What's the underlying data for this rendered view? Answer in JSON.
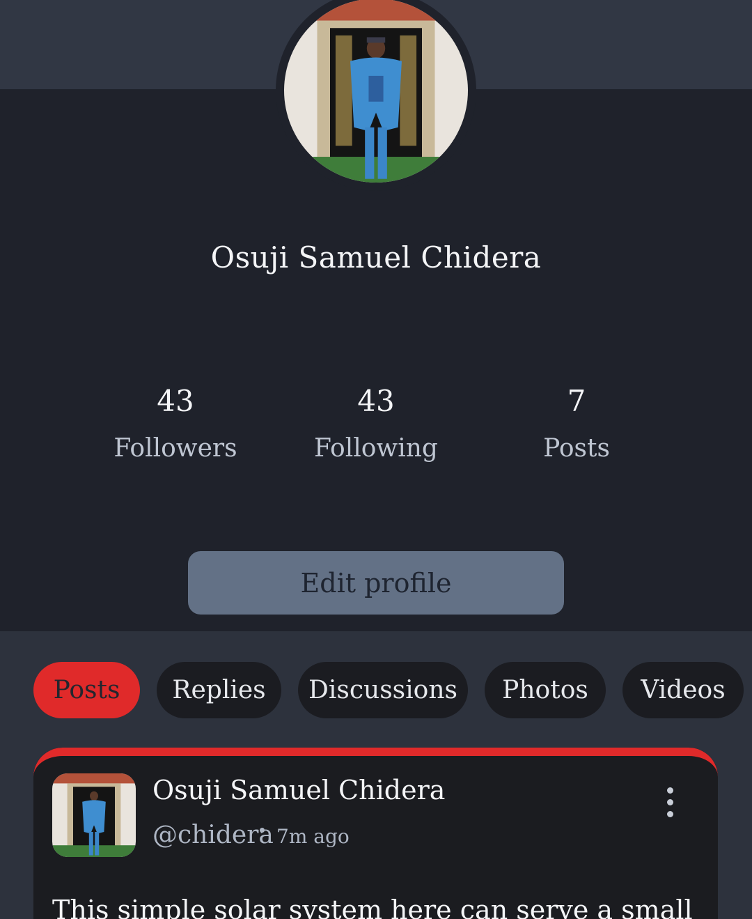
{
  "profile": {
    "display_name": "Osuji Samuel Chidera",
    "stats": [
      {
        "value": "43",
        "label": "Followers"
      },
      {
        "value": "43",
        "label": "Following"
      },
      {
        "value": "7",
        "label": "Posts"
      }
    ],
    "edit_label": "Edit profile"
  },
  "tabs": [
    {
      "label": "Posts",
      "active": true
    },
    {
      "label": "Replies",
      "active": false
    },
    {
      "label": "Discussions",
      "active": false
    },
    {
      "label": "Photos",
      "active": false
    },
    {
      "label": "Videos",
      "active": false
    }
  ],
  "post": {
    "author": "Osuji Samuel Chidera",
    "handle": "@chidera",
    "time": "7m ago",
    "text": "This simple solar system here can serve a small office or"
  },
  "icons": {
    "more": "more-vertical-icon"
  },
  "colors": {
    "accent": "#e02a2a",
    "background": "#1f222b",
    "cover": "#313744",
    "button": "#637186"
  }
}
